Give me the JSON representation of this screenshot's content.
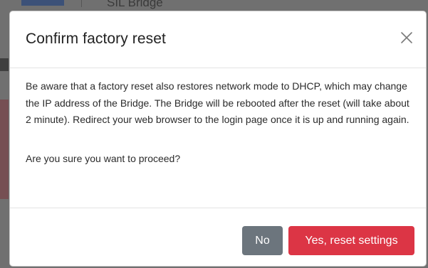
{
  "background": {
    "partial_title": "SIL Bridge"
  },
  "modal": {
    "title": "Confirm factory reset",
    "close_icon": "close-icon",
    "body_paragraph": "Be aware that a factory reset also restores network mode to DHCP, which may change the IP address of the Bridge. The Bridge will be rebooted after the reset (will take about 2 minute). Redirect your web browser to the login page once it is up and running again.",
    "question": "Are you sure you want to proceed?",
    "buttons": {
      "no_label": "No",
      "yes_label": "Yes, reset settings"
    }
  },
  "colors": {
    "no_button": "#6c757d",
    "yes_button": "#dc3545",
    "backdrop": "#707070"
  }
}
